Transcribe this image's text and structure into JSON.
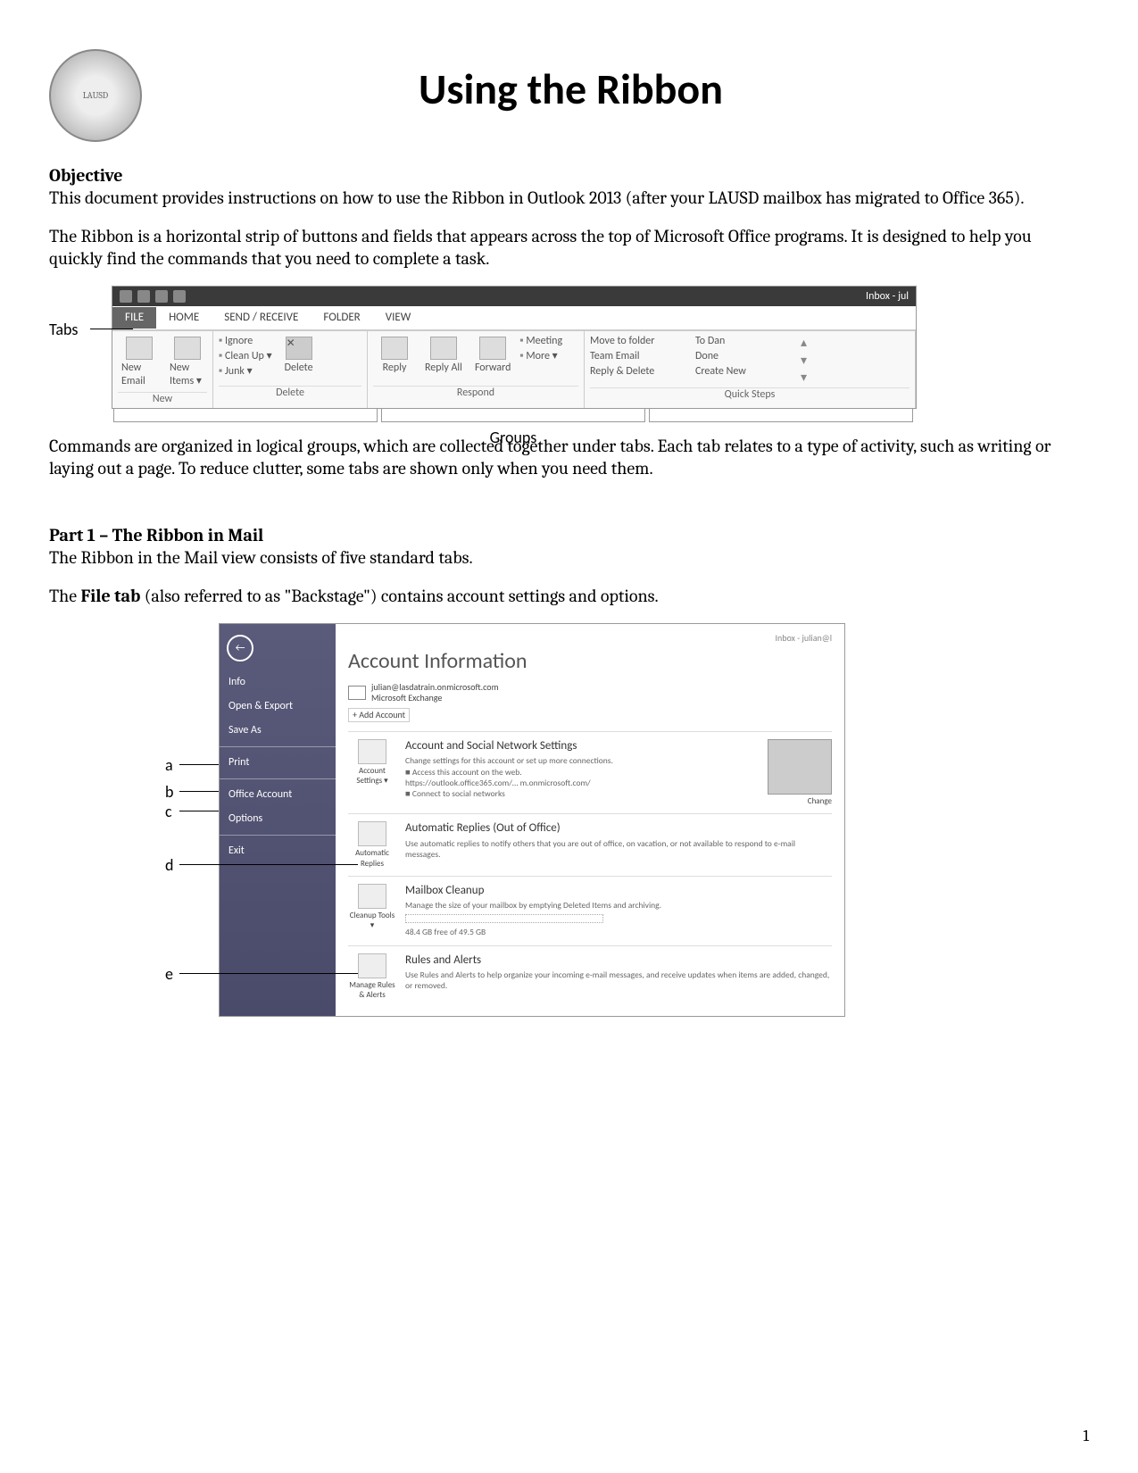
{
  "doc": {
    "title": "Using the Ribbon",
    "objective_heading": "Objective",
    "objective_text": "This document provides instructions on how to use the Ribbon in Outlook 2013 (after your LAUSD mailbox has migrated to Office 365).",
    "ribbon_intro": "The Ribbon is a horizontal strip of buttons and fields that appears across the top of Microsoft Office programs.  It is designed to help you quickly find the commands that you need to complete a task.",
    "tabs_label": "Tabs",
    "groups_label": "Groups",
    "commands_text": "Commands are organized in logical groups, which are collected together under tabs.  Each tab relates to a type of activity, such as writing or laying out a page.  To reduce clutter, some tabs are shown only when you need them.",
    "part1_heading": "Part 1 – The Ribbon in Mail",
    "part1_text": "The Ribbon in the Mail view consists of five standard tabs.",
    "file_tab_text_a": "The ",
    "file_tab_text_b": "File tab",
    "file_tab_text_c": " (also referred to as \"Backstage\") contains account settings and options.",
    "page_number": "1"
  },
  "ribbon": {
    "window_title": "Inbox - jul",
    "tabs": [
      "FILE",
      "HOME",
      "SEND / RECEIVE",
      "FOLDER",
      "VIEW"
    ],
    "groups": {
      "new": {
        "label": "New",
        "buttons": [
          "New Email",
          "New Items ▾"
        ]
      },
      "delete": {
        "label": "Delete",
        "side": [
          "Ignore",
          "Clean Up ▾",
          "Junk ▾"
        ],
        "main": "Delete"
      },
      "respond": {
        "label": "Respond",
        "buttons": [
          "Reply",
          "Reply All",
          "Forward"
        ],
        "side": [
          "Meeting",
          "More ▾"
        ]
      },
      "quicksteps": {
        "label": "Quick Steps",
        "col1": [
          "Move to folder",
          "Team Email",
          "Reply & Delete"
        ],
        "col2": [
          "To Dan",
          "Done",
          "Create New"
        ]
      }
    }
  },
  "backstage": {
    "header_right": "Inbox - julian@l",
    "side_items": [
      "Info",
      "Open & Export",
      "Save As",
      "",
      "Print",
      "",
      "Office Account",
      "Options",
      "",
      "Exit"
    ],
    "title": "Account Information",
    "account_email": "julian@lasdatrain.onmicrosoft.com",
    "account_type": "Microsoft Exchange",
    "add_account": "+ Add Account",
    "sections": [
      {
        "btn": "Account Settings ▾",
        "title": "Account and Social Network Settings",
        "desc": "Change settings for this account or set up more connections.\n■  Access this account on the web.\n     https://outlook.office365.com/…  m.onmicrosoft.com/\n■  Connect to social networks",
        "photo": true,
        "photo_caption": "Change"
      },
      {
        "btn": "Automatic Replies",
        "title": "Automatic Replies (Out of Office)",
        "desc": "Use automatic replies to notify others that you are out of office, on vacation, or not available to respond to e-mail messages."
      },
      {
        "btn": "Cleanup Tools ▾",
        "title": "Mailbox Cleanup",
        "desc": "Manage the size of your mailbox by emptying Deleted Items and archiving.",
        "quota": "48.4 GB free of 49.5 GB"
      },
      {
        "btn": "Manage Rules & Alerts",
        "title": "Rules and Alerts",
        "desc": "Use Rules and Alerts to help organize your incoming e-mail messages, and receive updates when items are added, changed, or removed."
      }
    ],
    "legend": {
      "a": "a",
      "b": "b",
      "c": "c",
      "d": "d",
      "e": "e"
    }
  }
}
